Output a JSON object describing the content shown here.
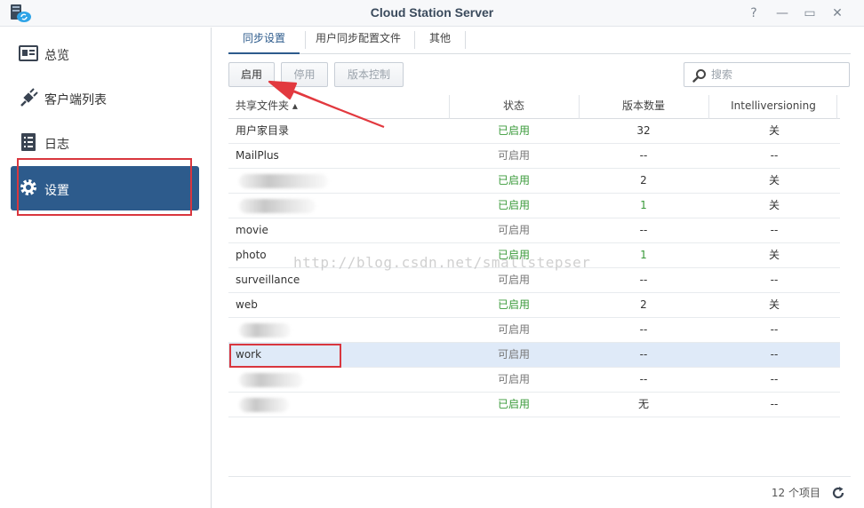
{
  "window": {
    "title": "Cloud Station Server",
    "help_glyph": "?",
    "min_glyph": "—",
    "max_glyph": "▭",
    "close_glyph": "✕"
  },
  "sidebar": {
    "items": [
      {
        "label": "总览",
        "icon": "overview-icon"
      },
      {
        "label": "客户端列表",
        "icon": "plug-icon"
      },
      {
        "label": "日志",
        "icon": "log-icon"
      },
      {
        "label": "设置",
        "icon": "gear-icon",
        "active": true
      }
    ]
  },
  "tabs": [
    {
      "label": "同步设置",
      "active": true
    },
    {
      "label": "用户同步配置文件"
    },
    {
      "label": "其他"
    }
  ],
  "toolbar": {
    "enable_label": "启用",
    "disable_label": "停用",
    "version_label": "版本控制",
    "search_placeholder": "搜索"
  },
  "table": {
    "columns": [
      "共享文件夹 ▴",
      "状态",
      "版本数量",
      "Intelliversioning"
    ],
    "rows": [
      {
        "name": "用户家目录",
        "status": "已启用",
        "status_kind": "enabled",
        "count": "32",
        "iv": "关"
      },
      {
        "name": "MailPlus",
        "status": "可启用",
        "status_kind": "available",
        "count": "--",
        "iv": "--"
      },
      {
        "name": "",
        "blurred": 100,
        "status": "已启用",
        "status_kind": "enabled",
        "count": "2",
        "iv": "关"
      },
      {
        "name": "",
        "blurred": 86,
        "status": "已启用",
        "status_kind": "enabled",
        "count": "1",
        "iv": "关"
      },
      {
        "name": "movie",
        "status": "可启用",
        "status_kind": "available",
        "count": "--",
        "iv": "--"
      },
      {
        "name": "photo",
        "status": "已启用",
        "status_kind": "enabled",
        "count": "1",
        "iv": "关"
      },
      {
        "name": "surveillance",
        "status": "可启用",
        "status_kind": "available",
        "count": "--",
        "iv": "--"
      },
      {
        "name": "web",
        "status": "已启用",
        "status_kind": "enabled",
        "count": "2",
        "iv": "关"
      },
      {
        "name": "",
        "blurred": 58,
        "status": "可启用",
        "status_kind": "available",
        "count": "--",
        "iv": "--"
      },
      {
        "name": "work",
        "selected": true,
        "status": "可启用",
        "status_kind": "available",
        "count": "--",
        "iv": "--"
      },
      {
        "name": "",
        "blurred": 72,
        "status": "可启用",
        "status_kind": "available",
        "count": "--",
        "iv": "--"
      },
      {
        "name": "",
        "blurred": 56,
        "status": "已启用",
        "status_kind": "enabled",
        "count": "无",
        "iv": "--"
      }
    ]
  },
  "footer": {
    "item_count": "12 个项目"
  },
  "watermark": "http://blog.csdn.net/smallstepser",
  "colors": {
    "accent": "#2d5b8c",
    "enabled": "#3a9a3a",
    "annotation": "#d9363e",
    "selected_row": "#dfeaf8"
  }
}
